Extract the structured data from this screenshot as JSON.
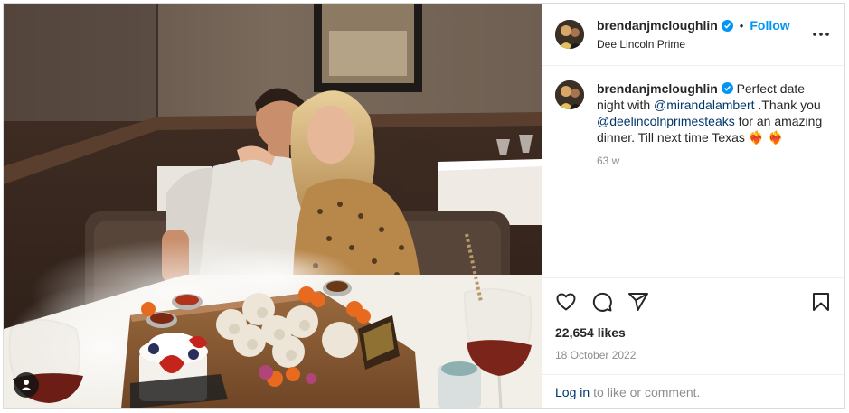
{
  "post": {
    "username": "brendanjmcloughlin",
    "separator": "•",
    "follow_label": "Follow",
    "location": "Dee Lincoln Prime",
    "caption": {
      "username": "brendanjmcloughlin",
      "text_1": "Perfect date night with ",
      "mention_1": "@mirandalambert",
      "text_2": " .Thank you ",
      "mention_2": "@deelincolnprimesteaks",
      "text_3": " for an amazing dinner. Till next time Texas ",
      "emoji": "❤️‍🔥 ❤️‍🔥",
      "time": "63 w"
    },
    "likes": "22,654 likes",
    "date": "18 October 2022",
    "login": {
      "link": "Log in",
      "text": "to like or comment."
    }
  },
  "colors": {
    "accent": "#0095f6",
    "verified": "#0095f6",
    "mention": "#00376b",
    "muted": "#8e8e8e"
  },
  "icons": [
    "verified-icon",
    "more-icon",
    "heart-icon",
    "comment-icon",
    "share-icon",
    "bookmark-icon",
    "user-tag-icon"
  ]
}
